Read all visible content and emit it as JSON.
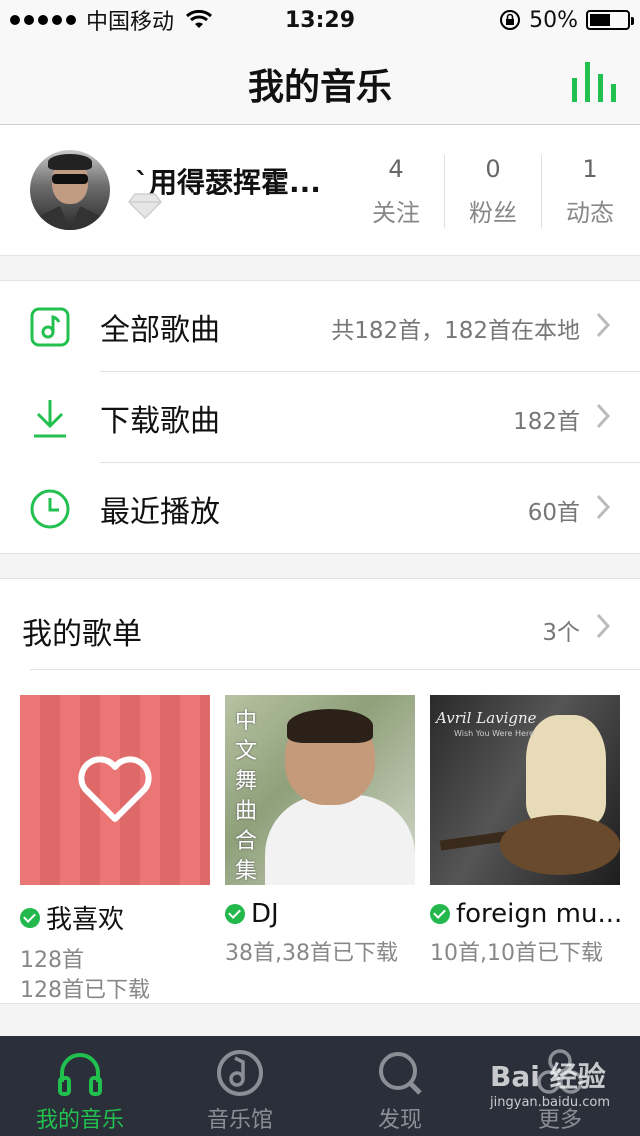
{
  "status_bar": {
    "carrier": "中国移动",
    "time": "13:29",
    "battery": "50%"
  },
  "nav": {
    "title": "我的音乐"
  },
  "profile": {
    "username": "ˋ用得瑟挥霍...",
    "stats": [
      {
        "num": "4",
        "label": "关注"
      },
      {
        "num": "0",
        "label": "粉丝"
      },
      {
        "num": "1",
        "label": "动态"
      }
    ]
  },
  "menu": {
    "items": [
      {
        "label": "全部歌曲",
        "detail": "共182首，182首在本地",
        "icon": "music-note-icon"
      },
      {
        "label": "下载歌曲",
        "detail": "182首",
        "icon": "download-icon"
      },
      {
        "label": "最近播放",
        "detail": "60首",
        "icon": "clock-icon"
      }
    ]
  },
  "playlists": {
    "title": "我的歌单",
    "count": "3个",
    "items": [
      {
        "name": "我喜欢",
        "info1": "128首",
        "info2": "128首已下载"
      },
      {
        "name": "DJ",
        "info1": "38首,38首已下载",
        "cover_text": "中文舞曲合集"
      },
      {
        "name": "foreign mu...",
        "info1": "10首,10首已下载",
        "cover_text": "Avril Lavigne",
        "cover_sub": "Wish You Were Here"
      }
    ]
  },
  "tabbar": {
    "tabs": [
      {
        "label": "我的音乐"
      },
      {
        "label": "音乐馆"
      },
      {
        "label": "发现"
      },
      {
        "label": "更多"
      }
    ]
  },
  "watermark": {
    "main": "Bai 经验",
    "sub": "jingyan.baidu.com"
  },
  "colors": {
    "accent": "#22c04f",
    "tabbar_bg": "#2b2f3a",
    "cover_red": "#ea6f6f"
  }
}
